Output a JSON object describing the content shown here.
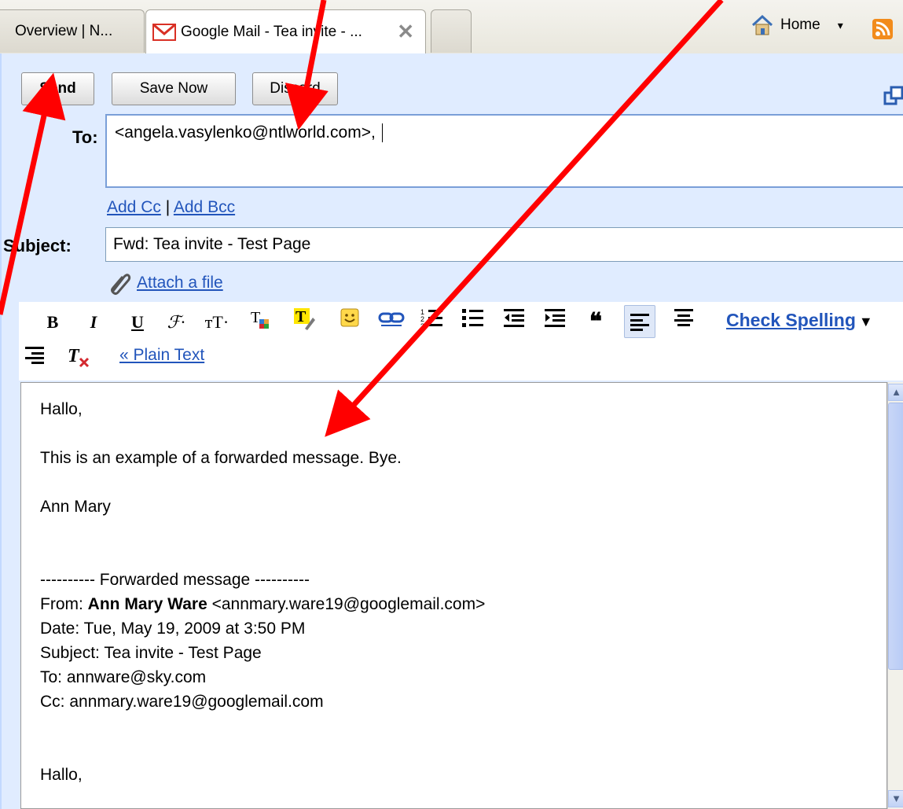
{
  "tabs": [
    {
      "label": "Overview | N..."
    },
    {
      "label": "Google Mail - Tea invite - ...",
      "close": "✕"
    },
    {
      "label": ""
    }
  ],
  "browser": {
    "home_label": "Home",
    "dropdown_glyph": "▾"
  },
  "toolbar": {
    "send_label": "Send",
    "save_label": "Save Now",
    "discard_label": "Discard"
  },
  "to": {
    "label": "To:",
    "value": "<angela.vasylenko@ntlworld.com>,"
  },
  "cc": {
    "add_cc": "Add Cc",
    "separator": "|",
    "add_bcc": "Add Bcc"
  },
  "subject": {
    "label": "Subject:",
    "value": "Fwd: Tea invite - Test Page"
  },
  "attach": {
    "label": "Attach a file"
  },
  "format": {
    "check_spelling": "Check Spelling",
    "spell_arrow": "▼",
    "plain_text": "« Plain Text"
  },
  "body": {
    "greeting": "Hallo,",
    "line1": "This is an example of a forwarded message.  Bye.",
    "signature": "Ann Mary",
    "fwd_header": "---------- Forwarded message ----------",
    "from_prefix": "From: ",
    "from_name": "Ann Mary Ware",
    "from_email": " <annmary.ware19@googlemail.com>",
    "date": "Date: Tue, May 19, 2009 at 3:50 PM",
    "subject": "Subject: Tea invite - Test Page",
    "to": "To: annware@sky.com",
    "cc": "Cc: annmary.ware19@googlemail.com",
    "greeting2": "Hallo,"
  },
  "colors": {
    "compose_bg": "#e0ecff",
    "link": "#2255bb",
    "annotation_arrow": "#ff0000"
  }
}
